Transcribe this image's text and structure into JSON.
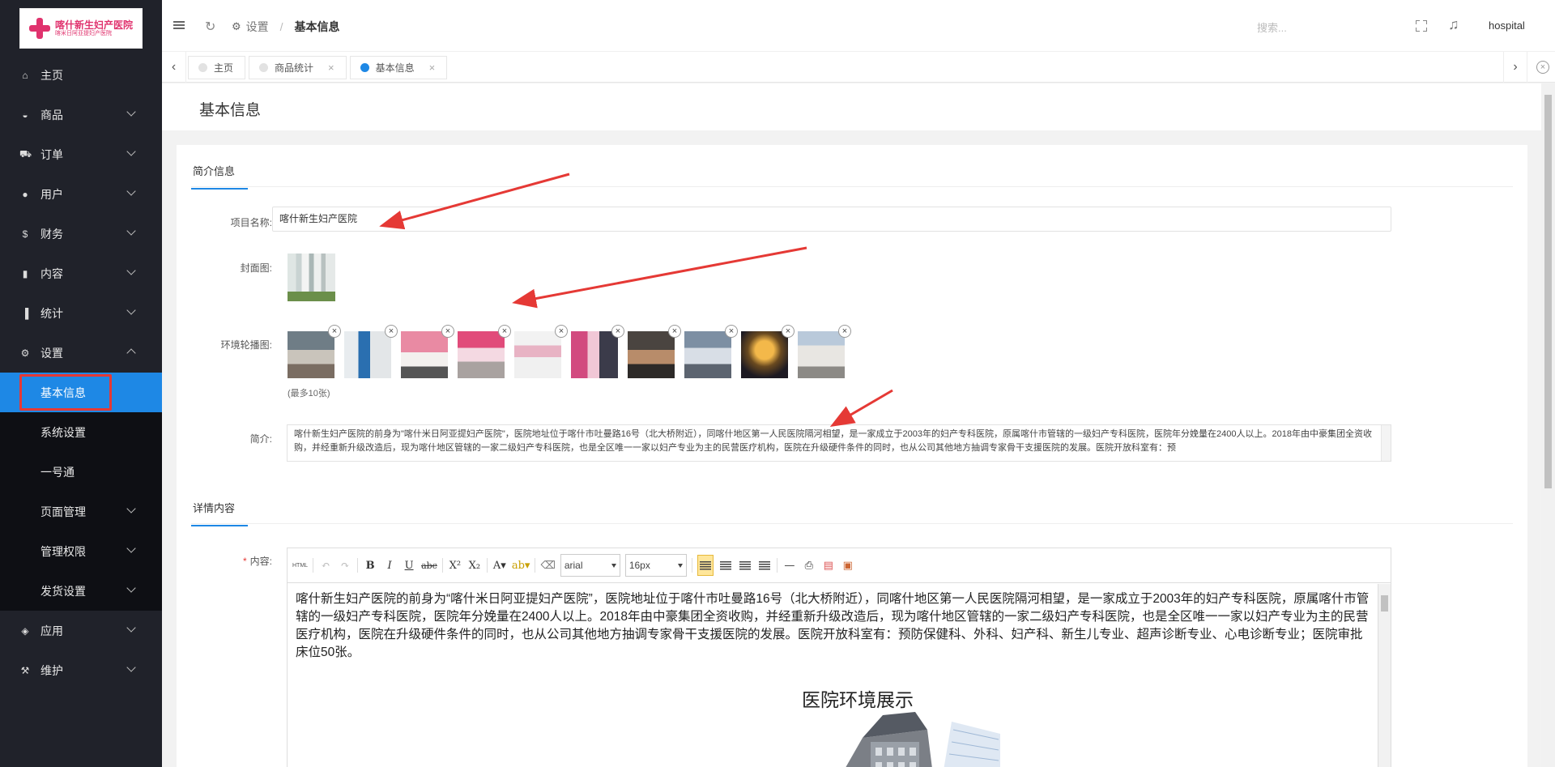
{
  "logo": {
    "line1": "喀什新生妇产医院",
    "line2": "喀米日阿亚提妇产医院"
  },
  "sidebar": {
    "items": [
      {
        "label": "主页",
        "icon": "home-icon",
        "glyph": "⌂"
      },
      {
        "label": "商品",
        "icon": "basket-icon",
        "glyph": "◒"
      },
      {
        "label": "订单",
        "icon": "cart-icon",
        "glyph": "⛟"
      },
      {
        "label": "用户",
        "icon": "user-icon",
        "glyph": "●"
      },
      {
        "label": "财务",
        "icon": "dollar-icon",
        "glyph": "$"
      },
      {
        "label": "内容",
        "icon": "book-icon",
        "glyph": "▮"
      },
      {
        "label": "统计",
        "icon": "bar-chart-icon",
        "glyph": "▐"
      },
      {
        "label": "设置",
        "icon": "gear-icon",
        "glyph": "⚙"
      }
    ],
    "submenu": [
      "基本信息",
      "系统设置",
      "一号通",
      "页面管理",
      "管理权限",
      "发货设置"
    ],
    "bottom": [
      {
        "label": "应用",
        "icon": "cube-icon",
        "glyph": "◈"
      },
      {
        "label": "维护",
        "icon": "hammer-icon",
        "glyph": "⚒"
      }
    ]
  },
  "header": {
    "breadcrumb_parent": "设置",
    "breadcrumb_current": "基本信息",
    "search_placeholder": "搜索...",
    "username": "hospital"
  },
  "tabs": [
    {
      "label": "主页",
      "closable": false
    },
    {
      "label": "商品统计",
      "closable": true
    },
    {
      "label": "基本信息",
      "closable": true,
      "active": true
    }
  ],
  "page": {
    "title": "基本信息",
    "section1": "简介信息",
    "section2": "详情内容",
    "fields": {
      "name_label": "项目名称:",
      "name_value": "喀什新生妇产医院",
      "cover_label": "封面图:",
      "carousel_label": "环境轮播图:",
      "carousel_hint": "(最多10张)",
      "intro_label": "简介:",
      "intro_value": "喀什新生妇产医院的前身为\"喀什米日阿亚提妇产医院\"，医院地址位于喀什市吐曼路16号（北大桥附近），同喀什地区第一人民医院隔河相望，是一家成立于2003年的妇产专科医院，原属喀什市管辖的一级妇产专科医院，医院年分娩量在2400人以上。2018年由中豪集团全资收购，并经重新升级改造后，现为喀什地区管辖的一家二级妇产专科医院，也是全区唯一一家以妇产专业为主的民营医疗机构，医院在升级硬件条件的同时，也从公司其他地方抽调专家骨干支援医院的发展。医院开放科室有：预",
      "content_label": "内容:"
    }
  },
  "editor": {
    "font": "arial",
    "size": "16px",
    "paragraph": "喀什新生妇产医院的前身为“喀什米日阿亚提妇产医院”，医院地址位于喀什市吐曼路16号（北大桥附近），同喀什地区第一人民医院隔河相望，是一家成立于2003年的妇产专科医院，原属喀什市管辖的一级妇产专科医院，医院年分娩量在2400人以上。2018年由中豪集团全资收购，并经重新升级改造后，现为喀什地区管辖的一家二级妇产专科医院，也是全区唯一一家以妇产专业为主的民营医疗机构，医院在升级硬件条件的同时，也从公司其他地方抽调专家骨干支援医院的发展。医院开放科室有：预防保健科、外科、妇产科、新生儿专业、超声诊断专业、心电诊断专业；医院审批床位50张。",
    "heading": "医院环境展示"
  },
  "colors": {
    "sidebar_bg": "#20222a",
    "accent": "#1e88e5",
    "highlight_box": "#e53935",
    "arrow": "#e53935"
  }
}
